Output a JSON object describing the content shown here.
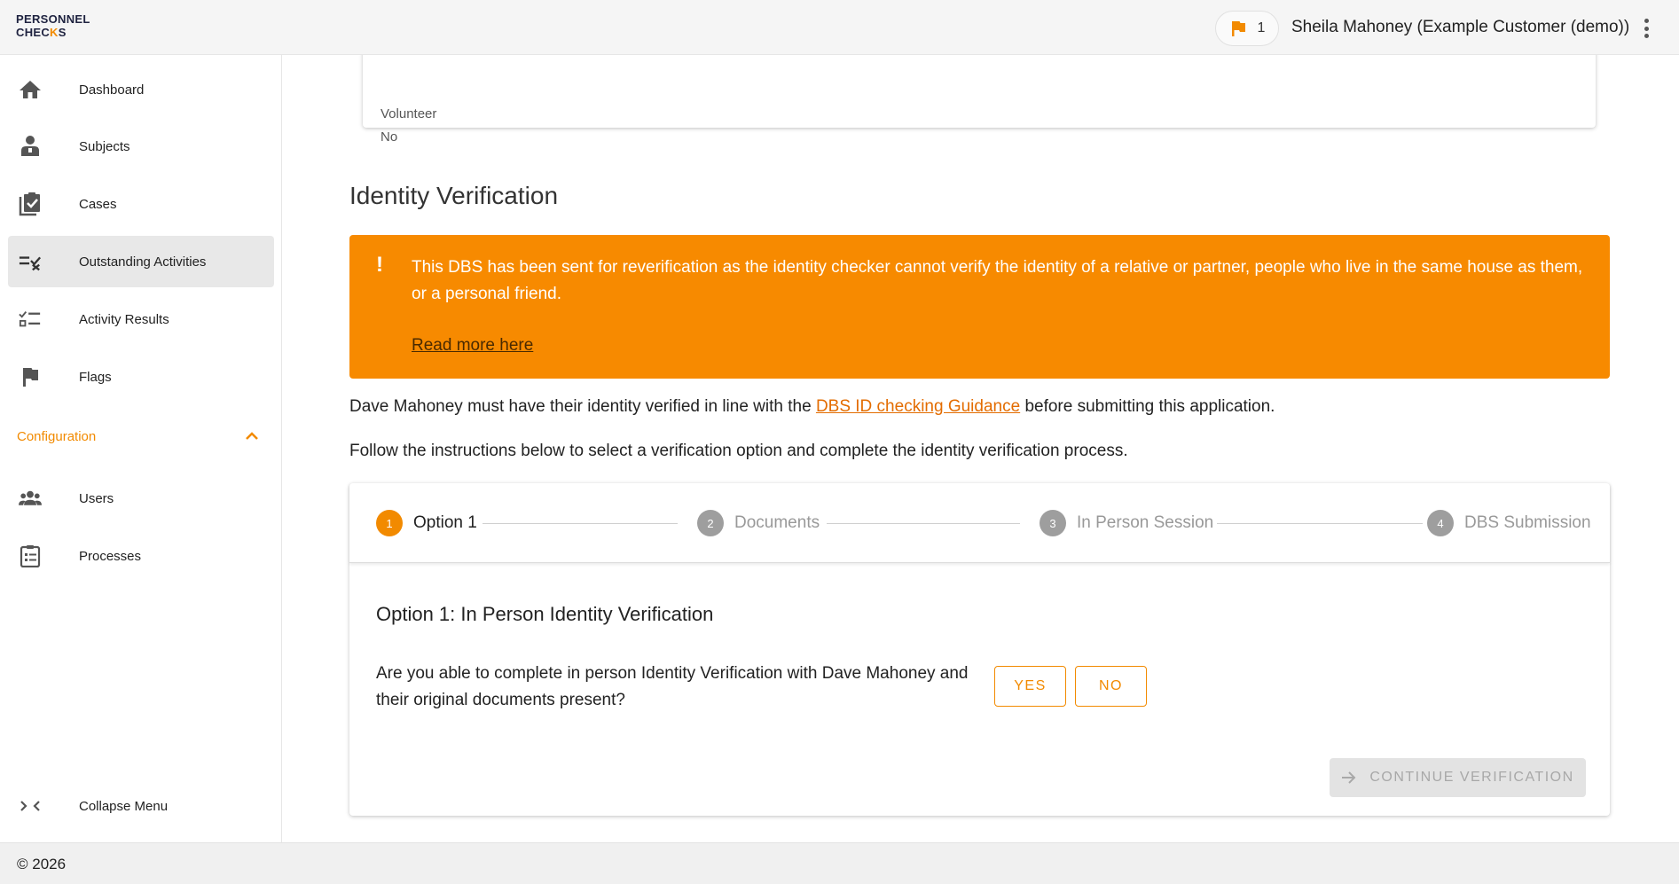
{
  "app": {
    "logo_line1": "PERSONNEL",
    "logo_line2_a": "CHEC",
    "logo_line2_b": "K",
    "logo_line2_c": "S"
  },
  "header": {
    "flag_count": "1",
    "user_name": "Sheila Mahoney (Example Customer (demo))"
  },
  "sidebar": {
    "items": [
      {
        "label": "Dashboard",
        "icon": "home-icon"
      },
      {
        "label": "Subjects",
        "icon": "person-icon"
      },
      {
        "label": "Cases",
        "icon": "clipboard-check-icon"
      },
      {
        "label": "Outstanding Activities",
        "icon": "playlist-check-icon"
      },
      {
        "label": "Activity Results",
        "icon": "checklist-icon"
      },
      {
        "label": "Flags",
        "icon": "flag-icon"
      }
    ],
    "config_label": "Configuration",
    "config_items": [
      {
        "label": "Users",
        "icon": "group-icon"
      },
      {
        "label": "Processes",
        "icon": "clipboard-list-icon"
      }
    ],
    "collapse_label": "Collapse Menu"
  },
  "footer": {
    "copyright": "© 2026"
  },
  "main": {
    "prev_card": {
      "label": "Volunteer",
      "value": "No"
    },
    "section_title": "Identity Verification",
    "alert": {
      "message": "This DBS has been sent for reverification as the identity checker cannot verify the identity of a relative or partner, people who live in the same house as them, or a personal friend.",
      "link": "Read more here"
    },
    "para1_before": "Dave Mahoney must have their identity verified in line with the ",
    "para1_link": "DBS ID checking Guidance",
    "para1_after": " before submitting this application.",
    "para2": "Follow the instructions below to select a verification option and complete the identity verification process.",
    "steps": [
      {
        "num": "1",
        "name": "Option 1"
      },
      {
        "num": "2",
        "name": "Documents"
      },
      {
        "num": "3",
        "name": "In Person Session"
      },
      {
        "num": "4",
        "name": "DBS Submission"
      }
    ],
    "option_title": "Option 1: In Person Identity Verification",
    "option_question": "Are you able to complete in person Identity Verification with Dave Mahoney and their original documents present?",
    "yes_label": "YES",
    "no_label": "NO",
    "continue_label": "CONTINUE VERIFICATION"
  },
  "colors": {
    "accent": "#f28a00",
    "alert_bg": "#f78a00",
    "link": "#e36c00"
  }
}
